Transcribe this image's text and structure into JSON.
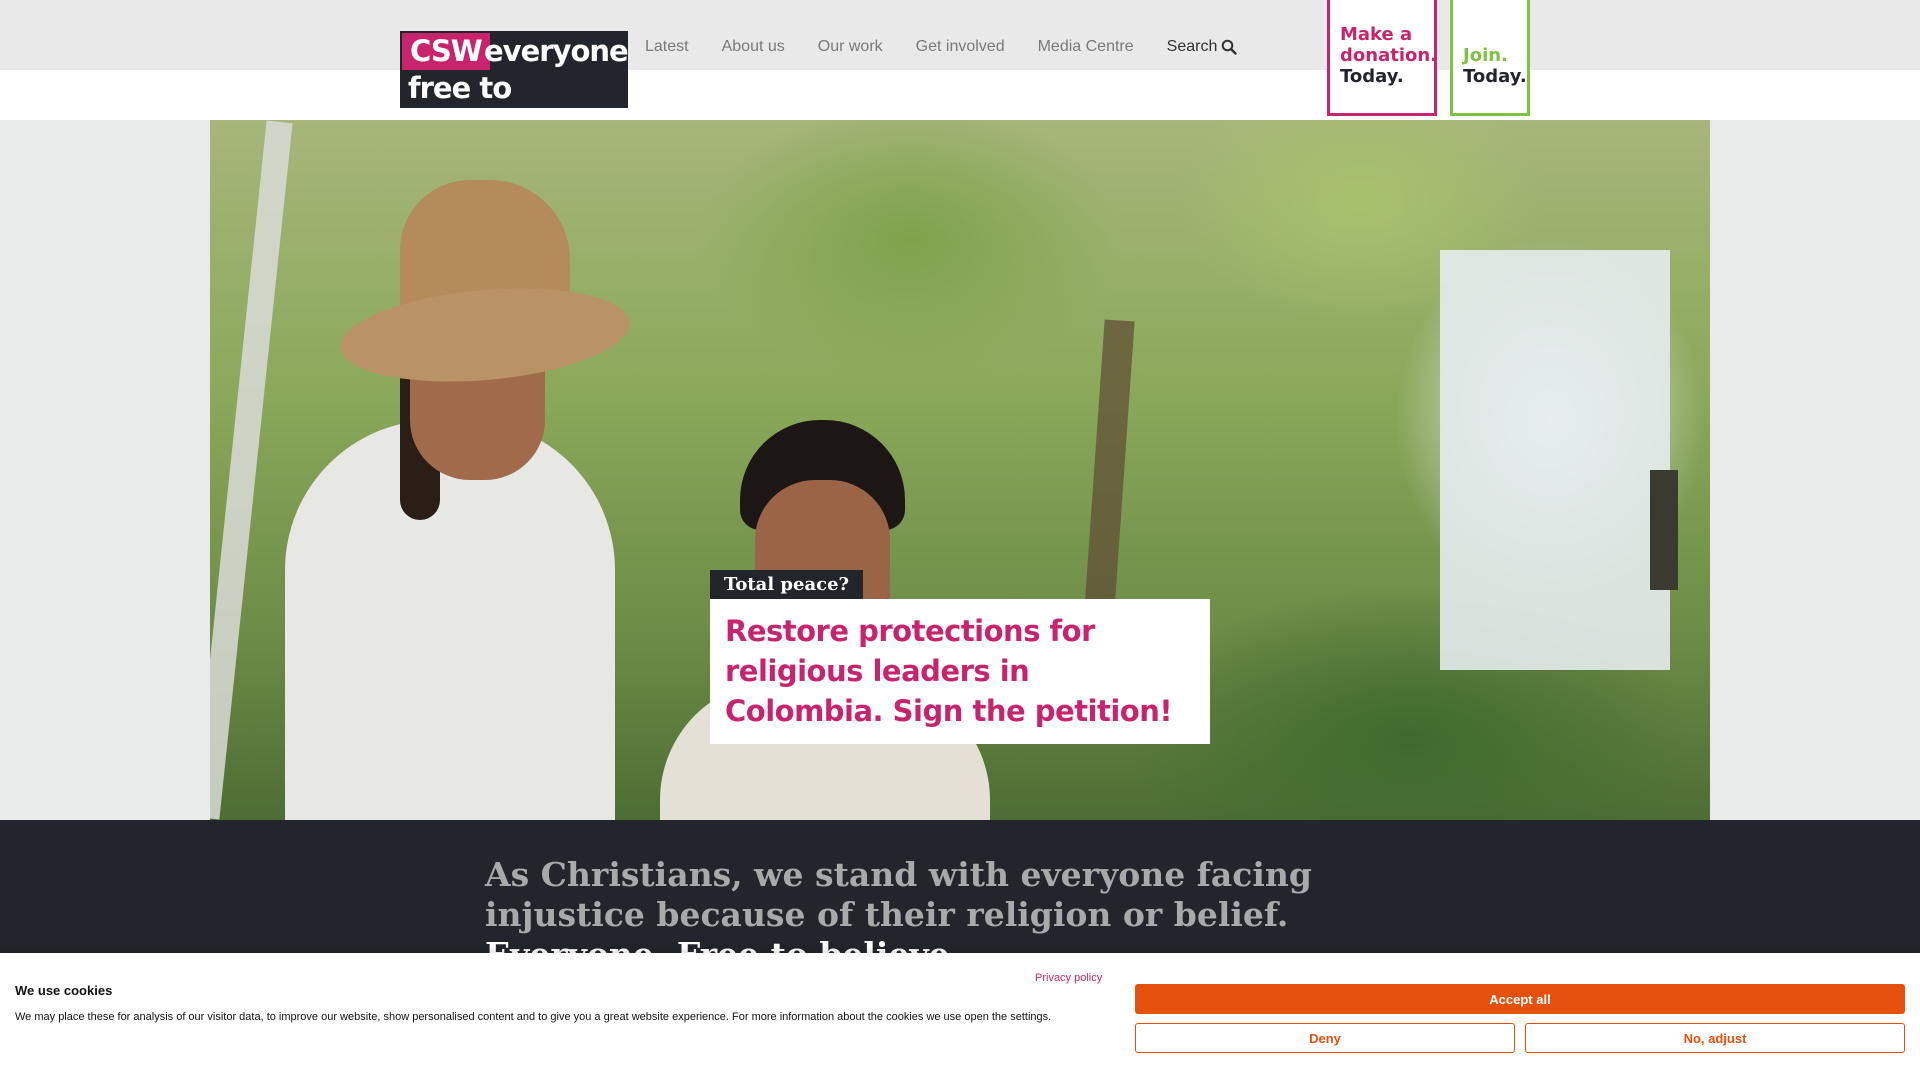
{
  "logo": {
    "abbr": "CSW",
    "word1": "everyone",
    "line2": "free to believe"
  },
  "nav": {
    "items": [
      {
        "label": "Latest"
      },
      {
        "label": "About us"
      },
      {
        "label": "Our work"
      },
      {
        "label": "Get involved"
      },
      {
        "label": "Media Centre"
      }
    ],
    "search_label": "Search"
  },
  "cta": {
    "donate": {
      "line1": "Make a",
      "line2": "donation.",
      "line3": "Today."
    },
    "join": {
      "line1": "Join.",
      "line2": "Today."
    }
  },
  "hero": {
    "tag": "Total peace?",
    "headline": "Restore protections for religious leaders in Colombia. Sign the petition!"
  },
  "statement": {
    "text": "As Christians, we stand with everyone facing injustice because of their religion or belief.",
    "tagline": "Everyone. Free to believe."
  },
  "cookie": {
    "title": "We use cookies",
    "text": "We may place these for analysis of our visitor data, to improve our website, show personalised content and to give you a great website experience. For more information about the cookies we use open the settings.",
    "privacy_link": "Privacy policy",
    "accept_label": "Accept all",
    "deny_label": "Deny",
    "adjust_label": "No, adjust"
  },
  "colors": {
    "brand_pink": "#c8246e",
    "brand_green": "#7cc243",
    "dark": "#22252b",
    "cookie_orange": "#e6500d"
  }
}
